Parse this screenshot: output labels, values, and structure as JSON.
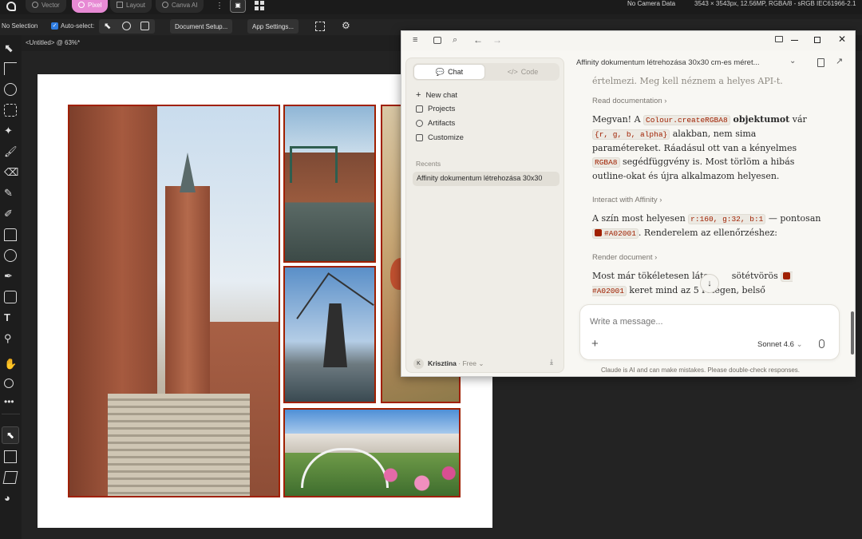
{
  "topbar": {
    "personas": [
      "Vector",
      "Pixel",
      "Layout",
      "Canva AI"
    ],
    "active_persona": "Pixel",
    "camera": "No Camera Data",
    "doc_info": "3543 × 3543px, 12.56MP, RGBA/8 - sRGB IEC61966-2.1"
  },
  "context_toolbar": {
    "selection": "No Selection",
    "auto_select_label": "Auto-select:",
    "auto_select_checked": true,
    "document_setup": "Document Setup...",
    "app_settings": "App Settings..."
  },
  "document": {
    "tab_title": "<Untitled> @ 63%*",
    "frame_color": "#A02001"
  },
  "claude": {
    "sidebar": {
      "tabs": [
        "Chat",
        "Code"
      ],
      "active_tab": "Chat",
      "items": [
        "New chat",
        "Projects",
        "Artifacts",
        "Customize"
      ],
      "recents_label": "Recents",
      "recent_items": [
        "Affinity dokumentum létrehozása 30x30"
      ],
      "user_initial": "K",
      "user_name": "Krisztina",
      "user_plan": "Free"
    },
    "conversation_title": "Affinity dokumentum létrehozása 30x30 cm-es méret...",
    "messages": {
      "faded_line": "értelmezi. Meg kell néznem a helyes API-t.",
      "tool1": "Read documentation",
      "p1_a": "Megvan! A ",
      "p1_code1": "Colour.createRGBA8",
      "p1_b": " objektumot",
      "p1_c": " vár ",
      "p1_code2": "{r, g, b, alpha}",
      "p1_d": " alakban, nem sima paramétereket. Ráadásul ott van a kényelmes ",
      "p1_code3": "RGBA8",
      "p1_e": " segédfüggvény is. Most törlöm a hibás outline-okat és újra alkalmazom helyesen.",
      "tool2": "Interact with Affinity",
      "p2_a": "A szín most helyesen ",
      "p2_code1": "r:160, g:32, b:1",
      "p2_b": " — pontosan ",
      "p2_code2": "#A02001",
      "p2_c": ". Renderelem az ellenőrzéshez:",
      "tool3": "Render document",
      "p3_a": "Most már tökéletesen láts",
      "p3_b": " sötétvörös ",
      "p3_code": "#A02001",
      "p3_c": " keret mind az 5 rétegen, belső"
    },
    "composer": {
      "placeholder": "Write a message...",
      "model": "Sonnet 4.6"
    },
    "disclaimer": "Claude is AI and can make mistakes. Please double-check responses."
  }
}
